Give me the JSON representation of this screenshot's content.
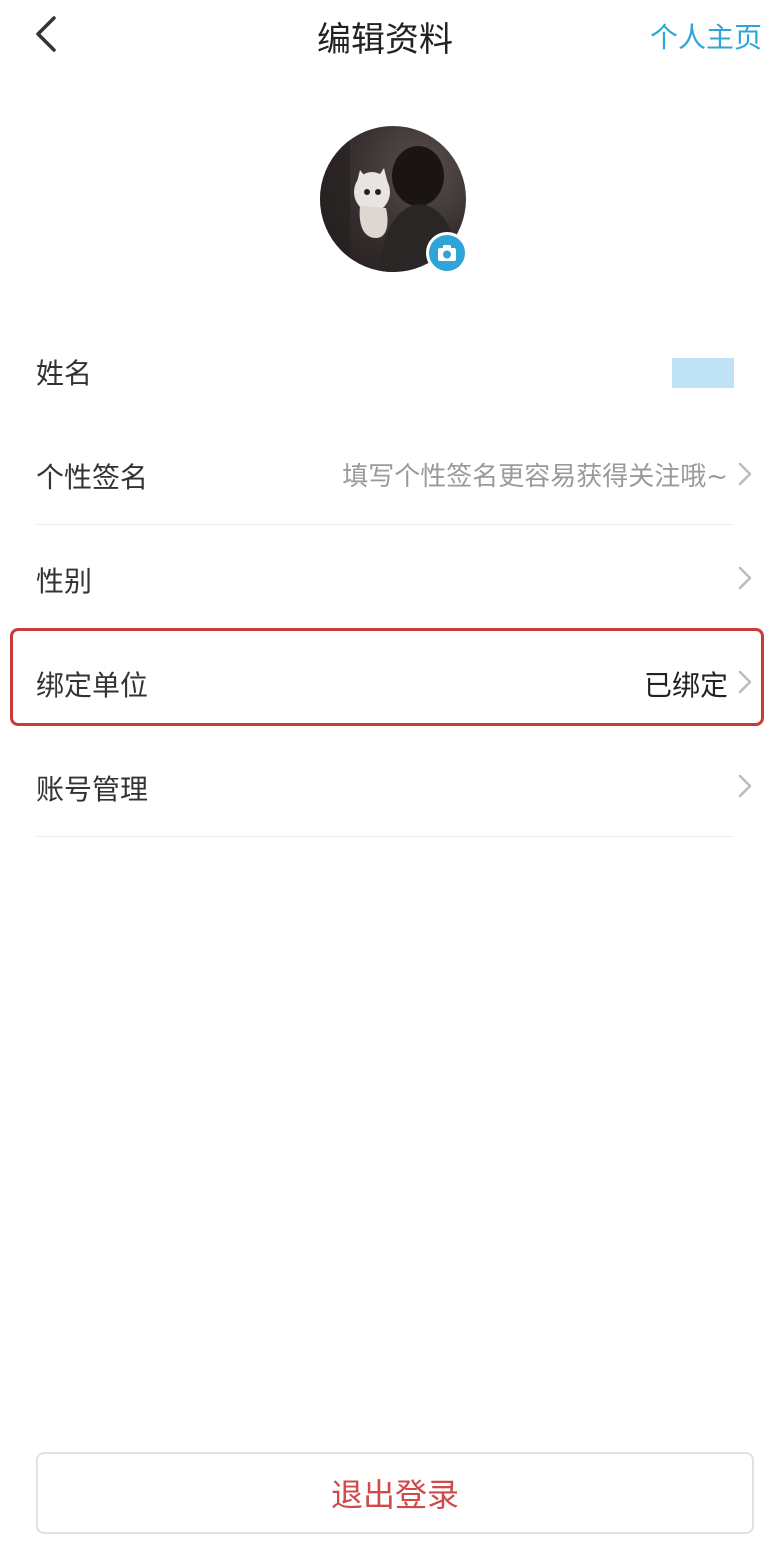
{
  "header": {
    "title": "编辑资料",
    "link": "个人主页"
  },
  "rows": [
    {
      "label": "姓名",
      "value": ""
    },
    {
      "label": "个性签名",
      "value": "填写个性签名更容易获得关注哦~"
    },
    {
      "label": "性别",
      "value": ""
    },
    {
      "label": "绑定单位",
      "value": "已绑定"
    },
    {
      "label": "账号管理",
      "value": ""
    }
  ],
  "logout": {
    "label": "退出登录"
  },
  "colors": {
    "accent": "#2fa4d8",
    "highlight": "#c83b3b",
    "logout_text": "#d04a4a"
  }
}
